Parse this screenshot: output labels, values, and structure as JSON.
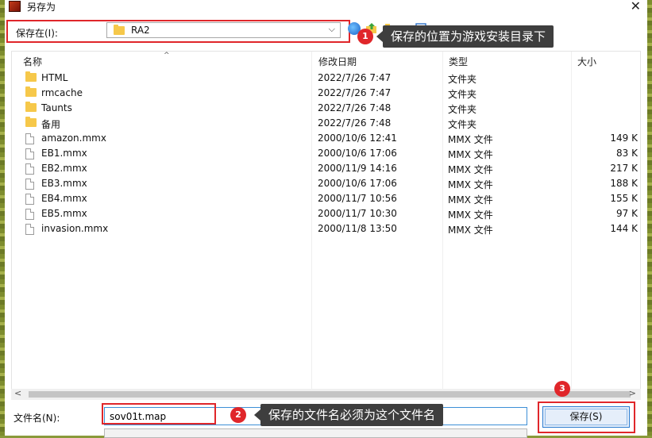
{
  "window": {
    "title": "另存为",
    "close_glyph": "✕"
  },
  "toolbar": {
    "save_in_label": "保存在(I):",
    "location_value": "RA2",
    "chevron": "⌵"
  },
  "annotations": [
    {
      "number": "1",
      "text": "保存的位置为游戏安装目录下"
    },
    {
      "number": "2",
      "text": "保存的文件名必须为这个文件名"
    },
    {
      "number": "3"
    }
  ],
  "columns": {
    "name": "名称",
    "date": "修改日期",
    "type": "类型",
    "size": "大小",
    "sort_glyph": "^"
  },
  "rows": [
    {
      "name": "HTML",
      "date": "2022/7/26 7:47",
      "type": "文件夹",
      "size": "",
      "icon": "folder-icon"
    },
    {
      "name": "rmcache",
      "date": "2022/7/26 7:47",
      "type": "文件夹",
      "size": "",
      "icon": "folder-icon"
    },
    {
      "name": "Taunts",
      "date": "2022/7/26 7:48",
      "type": "文件夹",
      "size": "",
      "icon": "folder-icon"
    },
    {
      "name": "备用",
      "date": "2022/7/26 7:48",
      "type": "文件夹",
      "size": "",
      "icon": "folder-icon"
    },
    {
      "name": "amazon.mmx",
      "date": "2000/10/6 12:41",
      "type": "MMX 文件",
      "size": "149 K",
      "icon": "file-icon"
    },
    {
      "name": "EB1.mmx",
      "date": "2000/10/6 17:06",
      "type": "MMX 文件",
      "size": "83 K",
      "icon": "file-icon"
    },
    {
      "name": "EB2.mmx",
      "date": "2000/11/9 14:16",
      "type": "MMX 文件",
      "size": "217 K",
      "icon": "file-icon"
    },
    {
      "name": "EB3.mmx",
      "date": "2000/10/6 17:06",
      "type": "MMX 文件",
      "size": "188 K",
      "icon": "file-icon"
    },
    {
      "name": "EB4.mmx",
      "date": "2000/11/7 10:56",
      "type": "MMX 文件",
      "size": "155 K",
      "icon": "file-icon"
    },
    {
      "name": "EB5.mmx",
      "date": "2000/11/7 10:30",
      "type": "MMX 文件",
      "size": "97 K",
      "icon": "file-icon"
    },
    {
      "name": "invasion.mmx",
      "date": "2000/11/8 13:50",
      "type": "MMX 文件",
      "size": "144 K",
      "icon": "file-icon"
    }
  ],
  "scroll": {
    "left_glyph": "<",
    "right_glyph": ">"
  },
  "footer": {
    "filename_label": "文件名(N):",
    "filename_value": "sov01t.map",
    "save_label": "保存(S)"
  },
  "colors": {
    "highlight": "#e0262a",
    "tooltip_bg": "#3e3e3e",
    "accent": "#2b7bd0"
  }
}
